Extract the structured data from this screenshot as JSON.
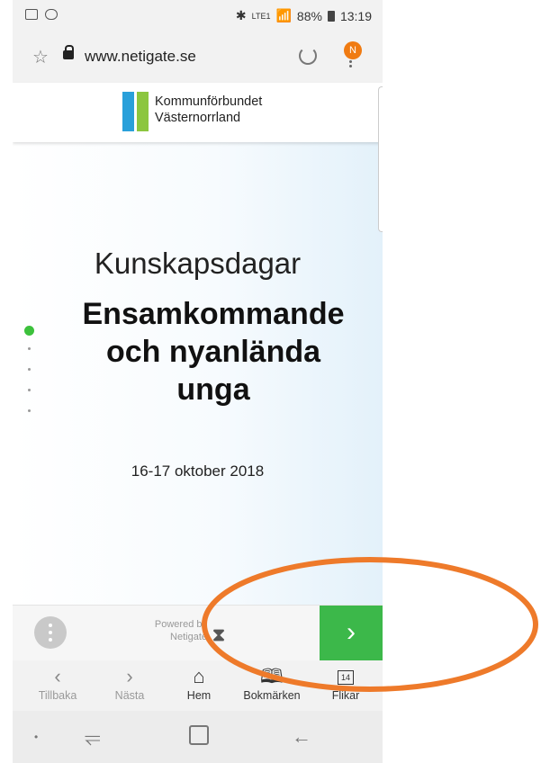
{
  "status_bar": {
    "network": "LTE1",
    "battery": "88%",
    "time": "13:19"
  },
  "browser": {
    "url": "www.netigate.se",
    "profile_initial": "N"
  },
  "page": {
    "org_line1": "Kommunförbundet",
    "org_line2": "Västernorrland",
    "eyebrow": "Kunskapsdagar",
    "headline_line1": "Ensamkommande",
    "headline_line2": "och nyanlända",
    "headline_line3": "unga",
    "date": "16-17 oktober 2018"
  },
  "survey_footer": {
    "powered_line1": "Powered by",
    "powered_line2": "Netigate",
    "next_icon": "chevron-right-icon"
  },
  "toolbar": {
    "items": [
      {
        "label": "Tillbaka",
        "icon": "back-icon"
      },
      {
        "label": "Nästa",
        "icon": "forward-icon"
      },
      {
        "label": "Hem",
        "icon": "home-icon"
      },
      {
        "label": "Bokmärken",
        "icon": "bookmarks-icon"
      },
      {
        "label": "Flikar",
        "icon": "tabs-icon",
        "count": "14"
      }
    ]
  },
  "colors": {
    "accent_green": "#3cb84a",
    "annotation": "#ee7a2a",
    "logo_blue": "#29a0da",
    "logo_green": "#8cc63f"
  }
}
